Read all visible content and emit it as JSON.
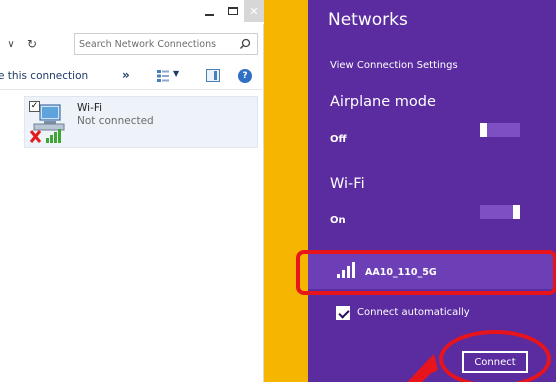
{
  "explorer": {
    "search": {
      "placeholder": "Search Network Connections"
    },
    "toolbar": {
      "rename_label": "e this connection",
      "more_label": "»"
    },
    "connection": {
      "name": "Wi-Fi",
      "status": "Not connected"
    }
  },
  "networks": {
    "title": "Networks",
    "settings_link": "View Connection Settings",
    "airplane": {
      "label": "Airplane mode",
      "state": "Off"
    },
    "wifi": {
      "label": "Wi-Fi",
      "state": "On"
    },
    "selected_network": {
      "ssid": "AA10_110_5G"
    },
    "connect_automatically": {
      "label": "Connect automatically",
      "checked": true
    },
    "connect_button": "Connect"
  },
  "colors": {
    "panel": "#5a2ca0",
    "strip": "#f6b500",
    "highlight": "#e8141b"
  }
}
